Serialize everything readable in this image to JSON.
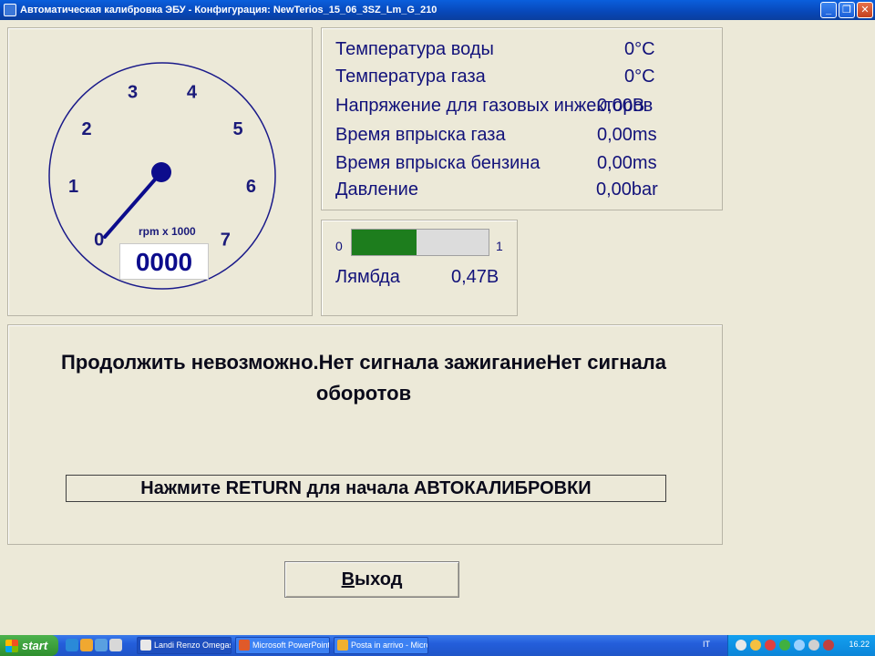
{
  "window": {
    "title": "Автоматическая калибровка ЭБУ - Конфигурация: NewTerios_15_06_3SZ_Lm_G_210",
    "minimize": "_",
    "maximize": "❐",
    "close": "✕"
  },
  "gauge": {
    "ticks": [
      "0",
      "1",
      "2",
      "3",
      "4",
      "5",
      "6",
      "7"
    ],
    "unit_label": "rpm x 1000",
    "value": "0000",
    "needle_rpm": 0
  },
  "info": {
    "rows": [
      {
        "label": "Температура воды",
        "value": "0°C"
      },
      {
        "label": "Температура газа",
        "value": "0°C"
      },
      {
        "label": "Напряжение для газовых инжекторов",
        "value": "0,00В"
      },
      {
        "label": "Время впрыска газа",
        "value": "0,00ms"
      },
      {
        "label": "Время впрыска бензина",
        "value": "0,00ms"
      },
      {
        "label": "Давление",
        "value": "0,00bar"
      }
    ]
  },
  "lambda": {
    "min_label": "0",
    "max_label": "1",
    "fill_fraction": 0.47,
    "label": "Лямбда",
    "value": "0,47В",
    "fill_color": "#1d7d1d"
  },
  "message": {
    "text": "Продолжить невозможно.Нет сигнала зажиганиеНет сигнала оборотов",
    "prompt": "Нажмите RETURN для начала АВТОКАЛИБРОВКИ"
  },
  "exit_button": {
    "accel": "В",
    "rest": "ыход"
  },
  "taskbar": {
    "start_label": "start",
    "tasks": [
      {
        "label": "Landi Renzo Omegas"
      },
      {
        "label": "Microsoft PowerPoint ..."
      },
      {
        "label": "Posta in arrivo - Micro..."
      }
    ],
    "language": "IT",
    "clock": "16.22"
  }
}
